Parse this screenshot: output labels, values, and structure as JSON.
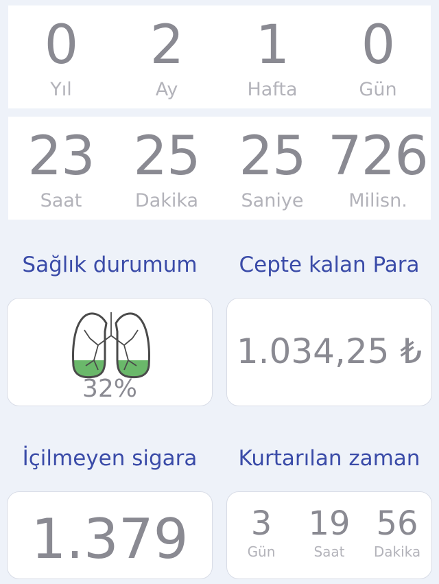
{
  "elapsed": {
    "row1": [
      {
        "value": "0",
        "label": "Yıl"
      },
      {
        "value": "2",
        "label": "Ay"
      },
      {
        "value": "1",
        "label": "Hafta"
      },
      {
        "value": "0",
        "label": "Gün"
      }
    ],
    "row2": [
      {
        "value": "23",
        "label": "Saat"
      },
      {
        "value": "25",
        "label": "Dakika"
      },
      {
        "value": "25",
        "label": "Saniye"
      },
      {
        "value": "726",
        "label": "Milisn."
      }
    ]
  },
  "health": {
    "title": "Sağlık durumum",
    "percent": "32%",
    "icon": "lungs-icon",
    "fill_color": "#6ab86a"
  },
  "money": {
    "title": "Cepte kalan Para",
    "value": "1.034,25 ₺"
  },
  "cigarettes": {
    "title": "İçilmeyen sigara",
    "value": "1.379"
  },
  "time_saved": {
    "title": "Kurtarılan zaman",
    "items": [
      {
        "value": "3",
        "label": "Gün"
      },
      {
        "value": "19",
        "label": "Saat"
      },
      {
        "value": "56",
        "label": "Dakika"
      }
    ]
  },
  "colors": {
    "title": "#3a4ba8",
    "number": "#8a8a92",
    "label": "#b3b3ba",
    "background": "#eef2f9"
  }
}
